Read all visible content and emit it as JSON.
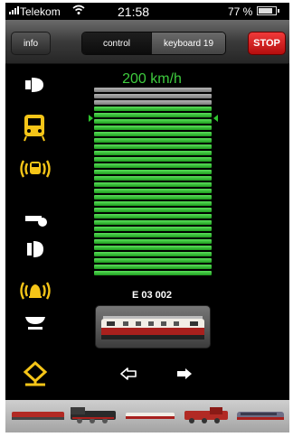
{
  "status_bar": {
    "carrier": "Telekom",
    "time": "21:58",
    "battery": "77 %",
    "battery_level": 0.77
  },
  "toolbar": {
    "info_label": "info",
    "segments": [
      "control",
      "keyboard 19"
    ],
    "selected_segment": "control",
    "stop_label": "STOP"
  },
  "speed": {
    "label": "200 km/h",
    "bars_total": 30,
    "bars_active": 27
  },
  "function_icons": [
    "headlight-icon",
    "train-front-icon",
    "horn-sound-icon",
    "whistle-icon",
    "lamp-icon",
    "bell-sound-icon",
    "ceiling-light-icon",
    "coupler-icon"
  ],
  "locomotive": {
    "name": "E 03 002"
  },
  "direction": {
    "back_icon": "arrow-left-outline-icon",
    "forward_icon": "arrow-right-filled-icon"
  },
  "footer": {
    "thumbnails": [
      "locomotive-thumb-1",
      "locomotive-thumb-2",
      "locomotive-thumb-3",
      "locomotive-thumb-4",
      "locomotive-thumb-5"
    ]
  },
  "colors": {
    "accent_green": "#3ecb3e",
    "icon_yellow": "#f5c518",
    "stop_red": "#d91e1e"
  }
}
